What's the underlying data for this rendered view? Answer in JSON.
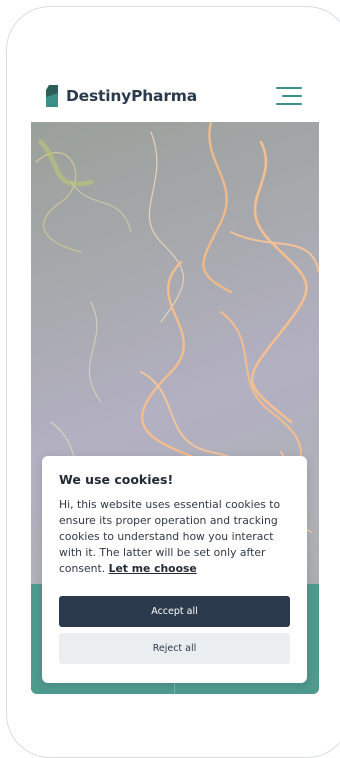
{
  "header": {
    "brand_name": "DestinyPharma",
    "logo_icon": "leaf-logo-icon",
    "menu_icon": "hamburger-menu-icon",
    "accent_color": "#3a8f86"
  },
  "hero": {
    "teal_color": "#4f9a8f"
  },
  "cookie_banner": {
    "title": "We use cookies!",
    "body": "Hi, this website uses essential cookies to ensure its proper operation and tracking cookies to understand how you interact with it. The latter will be set only after consent.",
    "link_label": "Let me choose",
    "accept_label": "Accept all",
    "reject_label": "Reject all",
    "accept_color": "#2c3a4d",
    "reject_color": "#eaeef0"
  }
}
